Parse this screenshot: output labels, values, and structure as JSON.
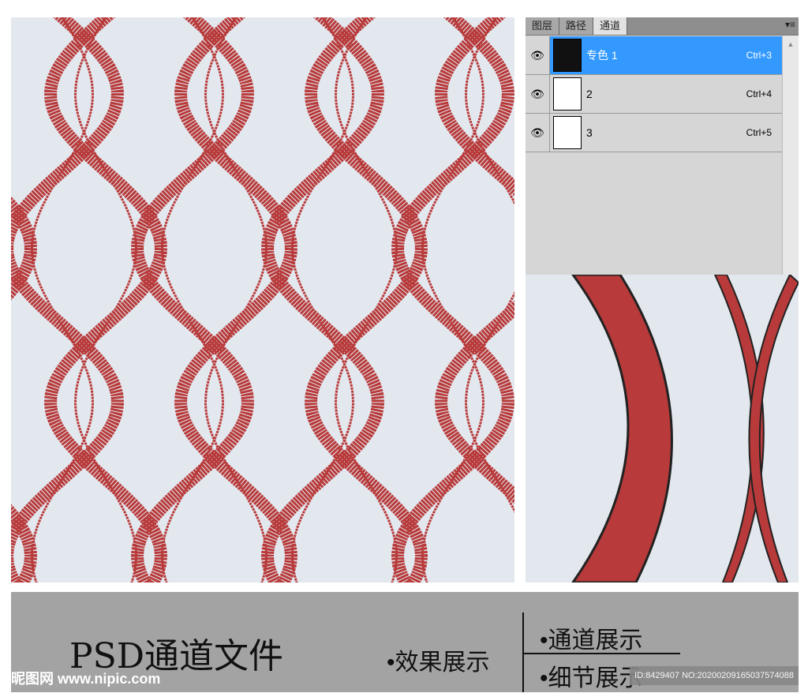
{
  "colors": {
    "accent": "#3399ff",
    "pattern_red": "#b83a3a",
    "pattern_bg": "#e3e8ef"
  },
  "panel": {
    "tabs": [
      "图层",
      "路径",
      "通道"
    ],
    "active_tab": "通道",
    "menu_icon": "panel-menu-icon",
    "channels": [
      {
        "name": "专色 1",
        "shortcut": "Ctrl+3",
        "selected": true
      },
      {
        "name": "2",
        "shortcut": "Ctrl+4",
        "selected": false
      },
      {
        "name": "3",
        "shortcut": "Ctrl+5",
        "selected": false
      }
    ]
  },
  "footer": {
    "title": "PSD通道文件",
    "effect": "•效果展示",
    "channels": "•通道展示",
    "detail": "•细节展示",
    "watermark": "昵图网 www.nipic.com",
    "id_text": "ID:8429407 NO:20200209165037574088"
  }
}
